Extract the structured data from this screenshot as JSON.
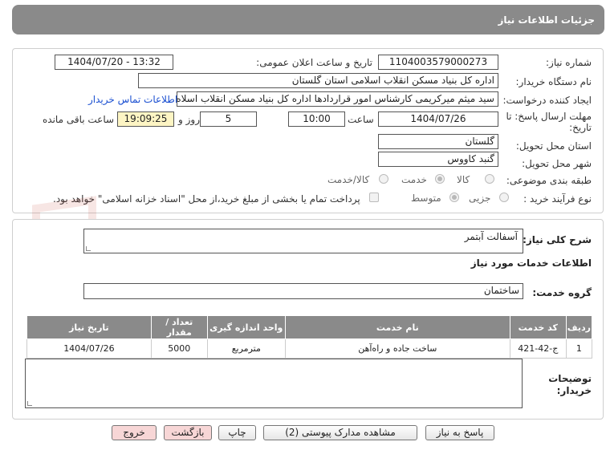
{
  "header": {
    "title": "جزئیات اطلاعات نیاز"
  },
  "form": {
    "need_number_label": "شماره نیاز:",
    "need_number": "1104003579000273",
    "announce_label": "تاریخ و ساعت اعلان عمومی:",
    "announce_value": "1404/07/20 - 13:32",
    "buyer_label": "نام دستگاه خریدار:",
    "buyer_value": "اداره کل بنیاد مسکن انقلاب اسلامی استان گلستان",
    "creator_label": "ایجاد کننده درخواست:",
    "creator_value": "سید میثم میرکریمی کارشناس امور قراردادها اداره کل بنیاد مسکن انقلاب اسلاه",
    "contact_link": "اطلاعات تماس خریدار",
    "deadline_label_1": "مهلت ارسال پاسخ: تا",
    "deadline_label_2": "تاریخ:",
    "deadline_date": "1404/07/26",
    "hour_label": "ساعت",
    "deadline_time": "10:00",
    "days_value": "5",
    "days_label": "روز و",
    "remaining_time": "19:09:25",
    "remaining_label": "ساعت باقی مانده",
    "province_label": "استان محل تحویل:",
    "province_value": "گلستان",
    "city_label": "شهر محل تحویل:",
    "city_value": "گنبد کاووس",
    "category_label": "طبقه بندی موضوعی:",
    "category_options": [
      "کالا",
      "خدمت",
      "کالا/خدمت"
    ],
    "category_selected": "خدمت",
    "process_label": "نوع فرآیند خرید :",
    "process_options": [
      "جزیی",
      "متوسط"
    ],
    "process_selected": "متوسط",
    "payment_note": "پرداخت تمام یا بخشی از مبلغ خرید،از محل \"اسناد خزانه اسلامی\" خواهد بود."
  },
  "details": {
    "summary_label": "شرح کلی نیاز:",
    "summary_value": "آسفالت آبتمر",
    "services_heading": "اطلاعات خدمات مورد نیاز",
    "service_group_label": "گروه خدمت:",
    "service_group_value": "ساختمان",
    "table": {
      "headers": [
        "ردیف",
        "کد خدمت",
        "نام خدمت",
        "واحد اندازه گیری",
        "تعداد / مقدار",
        "تاریخ نیاز"
      ],
      "rows": [
        [
          "1",
          "ج-42-421",
          "ساخت جاده و راه‌آهن",
          "مترمربع",
          "5000",
          "1404/07/26"
        ]
      ]
    },
    "buyer_notes_label_1": "توضیحات",
    "buyer_notes_label_2": "خریدار:"
  },
  "buttons": {
    "reply": "پاسخ به نیاز",
    "attachments": "مشاهده مدارک پیوستی (2)",
    "print": "چاپ",
    "back": "بازگشت",
    "exit": "خروج"
  },
  "watermark": {
    "text": "AriaTender.neT"
  },
  "colors": {
    "header_bg": "#8a8a8a",
    "link": "#1a4fd1",
    "highlight": "#fdf5c4",
    "watermark": "#c0392b"
  }
}
